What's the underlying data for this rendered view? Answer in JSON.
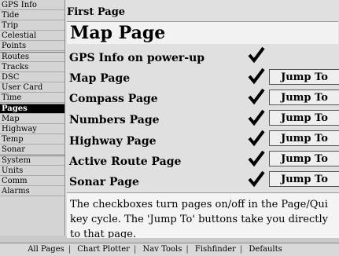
{
  "sidebar": {
    "items": [
      {
        "label": "GPS Info",
        "active": false
      },
      {
        "label": "Tide",
        "active": false
      },
      {
        "label": "Trip",
        "active": false
      },
      {
        "label": "Celestial",
        "active": false
      },
      {
        "label": "Points",
        "active": false
      },
      {
        "label": "Routes",
        "active": false
      },
      {
        "label": "Tracks",
        "active": false
      },
      {
        "label": "DSC",
        "active": false
      },
      {
        "label": "User Card",
        "active": false
      },
      {
        "label": "Time",
        "active": false
      },
      {
        "label": "Pages",
        "active": true
      },
      {
        "label": "Map",
        "active": false
      },
      {
        "label": "Highway",
        "active": false
      },
      {
        "label": "Temp",
        "active": false
      },
      {
        "label": "Sonar",
        "active": false
      },
      {
        "label": "System",
        "active": false
      },
      {
        "label": "Units",
        "active": false
      },
      {
        "label": "Comm",
        "active": false
      },
      {
        "label": "Alarms",
        "active": false
      }
    ]
  },
  "main": {
    "first_page_label": "First Page",
    "first_page_value": "Map Page",
    "rows": [
      {
        "label": "GPS Info on power-up",
        "checked": true,
        "jump": ""
      },
      {
        "label": "Map Page",
        "checked": true,
        "jump": "Jump To"
      },
      {
        "label": "Compass Page",
        "checked": true,
        "jump": "Jump To"
      },
      {
        "label": "Numbers Page",
        "checked": true,
        "jump": "Jump To"
      },
      {
        "label": "Highway Page",
        "checked": true,
        "jump": "Jump To"
      },
      {
        "label": "Active Route Page",
        "checked": true,
        "jump": "Jump To"
      },
      {
        "label": "Sonar Page",
        "checked": true,
        "jump": "Jump To"
      }
    ],
    "help_lines": [
      "The checkboxes turn pages on/off in the Page/Qui",
      "key cycle.  The 'Jump To' buttons take you directly",
      "to that page."
    ]
  },
  "bottom_tabs": [
    "All Pages",
    "Chart Plotter",
    "Nav Tools",
    "Fishfinder",
    "Defaults"
  ]
}
